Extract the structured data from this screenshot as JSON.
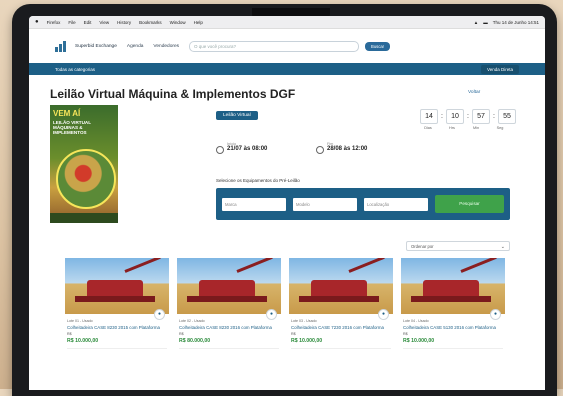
{
  "menubar": {
    "apple": "",
    "items": [
      "Firefox",
      "File",
      "Edit",
      "View",
      "History",
      "Bookmarks",
      "Window",
      "Help"
    ],
    "clock": "Thu 14 de Junho 14:51"
  },
  "header": {
    "logo_text": "Superbid Exchange",
    "nav": [
      "Agenda",
      "Vendedores"
    ],
    "search_placeholder": "O que você procura?",
    "search_button": "Buscar"
  },
  "navbar": {
    "left": "Todas as categorias",
    "right": "Venda Direta"
  },
  "event": {
    "title": "Leilão Virtual Máquina & Implementos DGF",
    "back": "Voltar",
    "badge": "Leilão Virtual",
    "start_label": "Início",
    "start_value": "21/07 às 08:00",
    "end_label": "Fim",
    "end_value": "28/08 às 12:00",
    "filter_caption": "Selecione os Equipamentos do Pré-Leilão",
    "filters": [
      "Marca",
      "Modelo",
      "Localização"
    ],
    "filter_button": "Pesquisar"
  },
  "poster": {
    "headline": "VEM AÍ",
    "sub": "LEILÃO VIRTUAL MÁQUINAS & IMPLEMENTOS"
  },
  "countdown": {
    "values": [
      "14",
      "10",
      "57",
      "55"
    ],
    "labels": [
      "Dias",
      "Hrs",
      "Min",
      "Seg"
    ]
  },
  "sort": {
    "value": "Ordenar por"
  },
  "lots": [
    {
      "lot": "Lote 01 - Usado",
      "name": "Colheitadeira CASE 8230 2015 com Plataforma",
      "cur": "R$",
      "price": "R$ 10.000,00"
    },
    {
      "lot": "Lote 02 - Usado",
      "name": "Colheitadeira CASE 8230 2016 com Plataforma",
      "cur": "R$",
      "price": "R$ 80.000,00"
    },
    {
      "lot": "Lote 03 - Usado",
      "name": "Colheitadeira CASE 7230 2016 com Plataforma",
      "cur": "R$",
      "price": "R$ 10.000,00"
    },
    {
      "lot": "Lote 04 - Usado",
      "name": "Colheitadeira CASE 5130 2016 com Plataforma",
      "cur": "R$",
      "price": "R$ 10.000,00"
    }
  ],
  "colors": {
    "primary": "#1d5f86",
    "accent": "#3fa24a",
    "price": "#2a8a3a"
  }
}
